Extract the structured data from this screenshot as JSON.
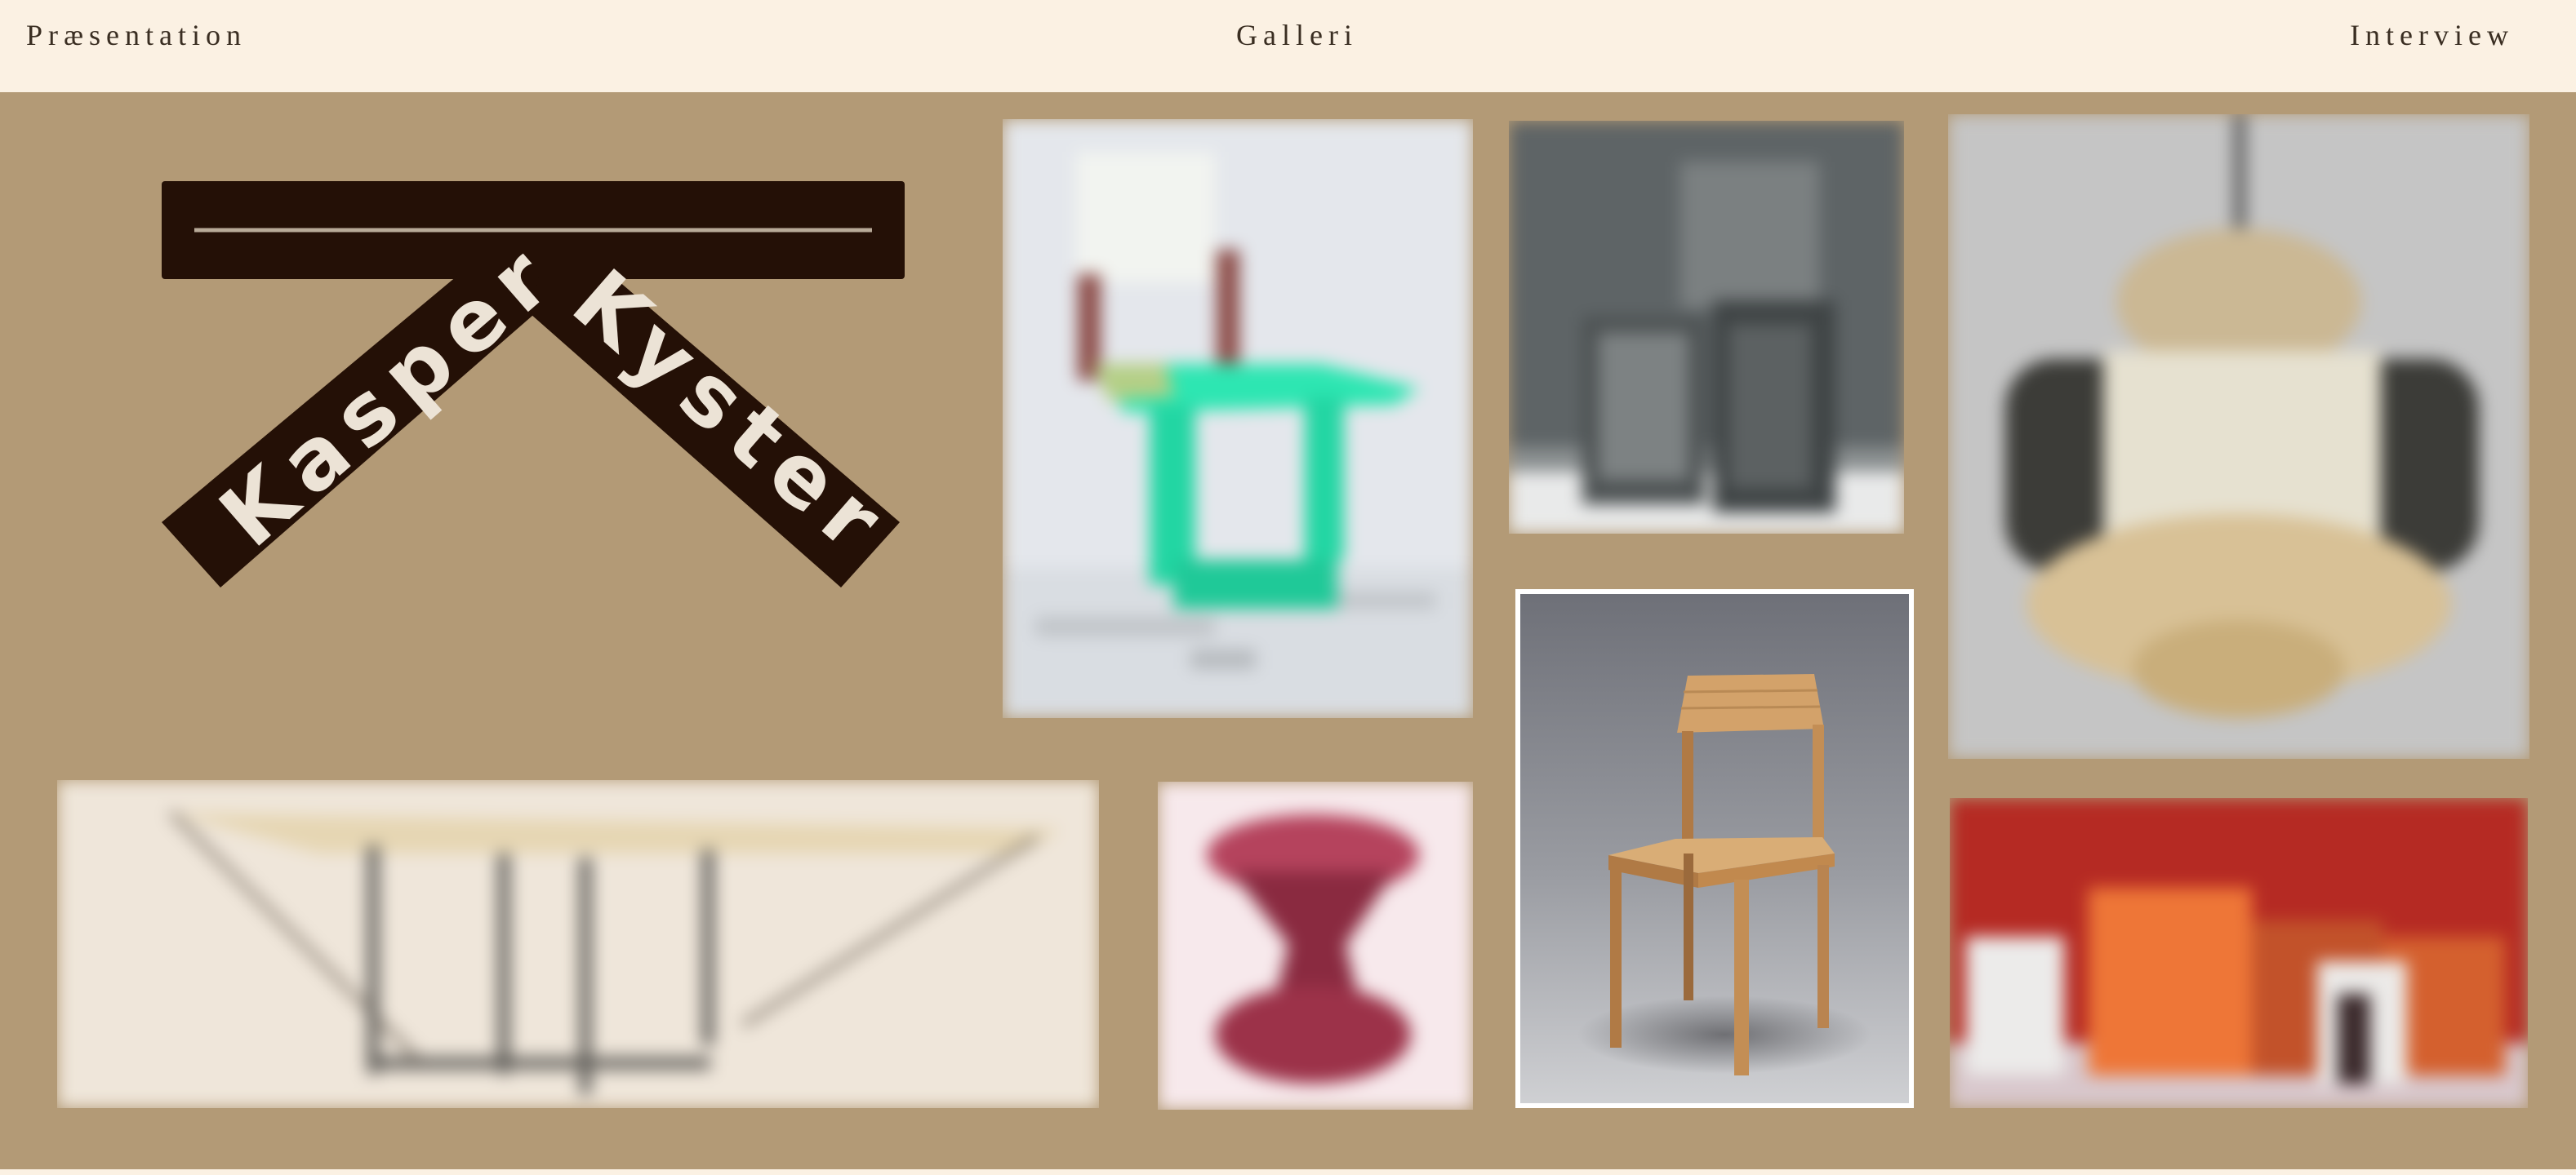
{
  "nav": {
    "left": "Præsentation",
    "center": "Galleri",
    "right": "Interview"
  },
  "logo": {
    "first_name": "Kasper",
    "last_name": "Kyster"
  },
  "colors": {
    "background": "#b39a76",
    "nav_background": "#fbf1e3",
    "logo_dark": "#241006",
    "logo_text": "#ece3d6"
  },
  "gallery": {
    "items": [
      {
        "id": "chair-teal",
        "description_icon": "chair-image"
      },
      {
        "id": "frames-gray",
        "description_icon": "frame-sculpture-image"
      },
      {
        "id": "pendant-lamp",
        "description_icon": "lamp-image"
      },
      {
        "id": "wooden-chair",
        "description_icon": "chair-image",
        "selected": true
      },
      {
        "id": "table-long",
        "description_icon": "table-image"
      },
      {
        "id": "stool-red",
        "description_icon": "stool-image"
      },
      {
        "id": "boxes-red",
        "description_icon": "shelf-image"
      }
    ]
  }
}
